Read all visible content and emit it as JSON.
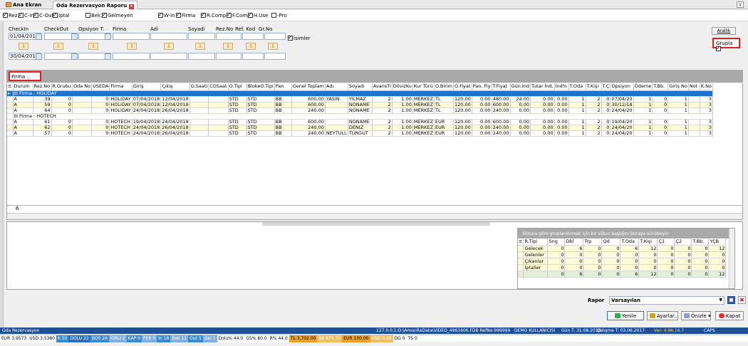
{
  "tabs": {
    "home": "Ana Ekran",
    "active": "Oda Rezervasyon Raporu",
    "close_glyph": "x",
    "chevron_glyph": "v"
  },
  "filters": [
    {
      "label": "Rez.",
      "checked": true
    },
    {
      "label": "C-In",
      "checked": true
    },
    {
      "label": "C-Out",
      "checked": true
    },
    {
      "label": "İptal",
      "checked": true
    },
    {
      "label": "Bek.",
      "checked": false
    },
    {
      "label": "Gelmeyen",
      "checked": true
    },
    {
      "label": "W-In",
      "checked": true
    },
    {
      "label": "Firma",
      "checked": true
    },
    {
      "label": "R.Comp",
      "checked": true
    },
    {
      "label": "F.Comp",
      "checked": true
    },
    {
      "label": "H.Use",
      "checked": true
    },
    {
      "label": "-Pro",
      "checked": false
    }
  ],
  "criteria": {
    "labels": [
      "CheckIn",
      "CheckOut",
      "Opsiyon T.",
      "Firma",
      "Adi",
      "Soyadi",
      "Rez.No",
      "Ref. Kod",
      "Gr.No"
    ],
    "checkin_from": "01/04/2018",
    "checkin_to": "30/04/2018",
    "isimler_label": "İsimler",
    "arallik_label": "Arallık",
    "grupla_label": "Grupla"
  },
  "group_chip": "Firma",
  "grid": {
    "columns": [
      "Durum",
      "Rez.No",
      "R.Grubu",
      "Oda No",
      "USEDA",
      "Firma",
      "Giriş",
      "Çıkış",
      "G.Saati",
      "COSaat",
      "O.Tipi",
      "BlokeO.Tipi",
      "Pan",
      "Genel Toplam",
      "Adı",
      "Soyadı",
      "AvansTi",
      "DövizKu",
      "Kur Türü",
      "O.Birim",
      "G.Fiyat",
      "Pan. Fiy",
      "T.Fiyat",
      "Gün.İnd",
      "Tutar İnd.",
      "İnd%",
      "T.Oda",
      "T.Kişi",
      "T.Ç",
      "Opsiyon",
      "Ödeme",
      "T.Bb.",
      "Giriş No",
      "Not",
      "K.No"
    ],
    "groups": [
      {
        "header": "Firma : HOLIDAY",
        "rows": [
          [
            "A",
            "39",
            "0",
            "",
            "0",
            "HOLIDAY",
            "07/04/2018",
            "12/04/2018",
            "",
            "",
            "STD",
            "STD",
            "BB",
            "600.00",
            "YASIN",
            "YILMAZ",
            "2",
            "1.00",
            "MERKEZ",
            "TL",
            "120.00",
            "0.00",
            "480.00",
            "24.00",
            "0.00",
            "0.00",
            "1",
            "2",
            "0",
            "07/04/20",
            "1",
            "0",
            "1",
            "",
            "3"
          ],
          [
            "A",
            "59",
            "0",
            "",
            "0",
            "HOLIDAY",
            "07/04/2018",
            "12/04/2018",
            "",
            "",
            "STD",
            "STD",
            "BB",
            "600.00",
            "",
            "NONAME",
            "2",
            "1.00",
            "MERKEZ",
            "TL",
            "120.00",
            "0.00",
            "600.00",
            "0.00",
            "0.00",
            "0.00",
            "1",
            "2",
            "0",
            "30/12/18",
            "1",
            "0",
            "1",
            "",
            "3"
          ],
          [
            "A",
            "64",
            "0",
            "",
            "0",
            "HOLIDAY",
            "24/04/2018",
            "26/04/2018",
            "",
            "",
            "STD",
            "STD",
            "BB",
            "240.00",
            "",
            "NONAME",
            "2",
            "1.00",
            "MERKEZ",
            "TL",
            "120.00",
            "0.00",
            "240.00",
            "0.00",
            "0.00",
            "0.00",
            "1",
            "2",
            "0",
            "24/04/20",
            "1",
            "0",
            "1",
            "",
            "3"
          ]
        ]
      },
      {
        "header": "Firma : HOTECH",
        "rows": [
          [
            "A",
            "61",
            "0",
            "",
            "0",
            "HOTECH",
            "19/04/2018",
            "24/04/2018",
            "",
            "",
            "STD",
            "STD",
            "BB",
            "600.00",
            "",
            "NONAME",
            "2",
            "1.00",
            "MERKEZ",
            "EUR",
            "120.00",
            "0.00",
            "600.00",
            "0.00",
            "0.00",
            "0.00",
            "1",
            "2",
            "0",
            "19/04/20",
            "1",
            "0",
            "1",
            "",
            "3"
          ],
          [
            "A",
            "62",
            "0",
            "",
            "0",
            "HOTECH",
            "24/04/2018",
            "26/04/2018",
            "",
            "",
            "STD",
            "STD",
            "BB",
            "240.00",
            "",
            "DENIZ",
            "2",
            "1.00",
            "MERKEZ",
            "EUR",
            "120.00",
            "0.00",
            "240.00",
            "0.00",
            "0.00",
            "0.00",
            "1",
            "2",
            "0",
            "24/04/20",
            "1",
            "0",
            "1",
            "",
            "3"
          ],
          [
            "A",
            "57",
            "0",
            "",
            "0",
            "HOTECH",
            "24/04/2018",
            "26/04/2018",
            "",
            "",
            "STD",
            "STD",
            "BB",
            "240.00",
            "NEYTULL",
            "TURGUT",
            "2",
            "1.00",
            "MERKEZ",
            "EUR",
            "120.00",
            "0.00",
            "240.00",
            "0.00",
            "0.00",
            "0.00",
            "1",
            "2",
            "0",
            "24/04/20",
            "1",
            "0",
            "1",
            "",
            "3"
          ]
        ]
      }
    ],
    "footer_count": "6"
  },
  "pivot": {
    "hint": "Sütuna göre gruplandırmak için bir sütun başlığını buraya sürükleyin",
    "columns": [
      "R.Tipi",
      "Sng",
      "Dbl",
      "Trp",
      "Qd",
      "T.Oda",
      "T.Kişi",
      "Ç1",
      "Ç2",
      "T.Bb.",
      "YÇB"
    ],
    "rows": [
      [
        "Gelecek",
        "0",
        "6",
        "0",
        "0",
        "6",
        "12",
        "0",
        "0",
        "0",
        "12"
      ],
      [
        "Gelenler",
        "0",
        "0",
        "0",
        "0",
        "0",
        "0",
        "0",
        "0",
        "0",
        "0"
      ],
      [
        "Çıkanlar",
        "0",
        "0",
        "0",
        "0",
        "0",
        "0",
        "0",
        "0",
        "0",
        "0"
      ],
      [
        "İptaller",
        "0",
        "0",
        "0",
        "0",
        "0",
        "0",
        "0",
        "0",
        "0",
        "0"
      ]
    ],
    "total": [
      "",
      "0",
      "6",
      "0",
      "0",
      "6",
      "12",
      "0",
      "0",
      "0",
      "12"
    ]
  },
  "report": {
    "label": "Rapor",
    "selected": "Varsayılan"
  },
  "actions": {
    "yenile": "Yenile",
    "ayarlar": "Ayarlar..",
    "onizle": "Önizle",
    "kapat": "Kapat"
  },
  "status": {
    "app": "Oda Rezervasyon",
    "db": "127.0.0.1:D:\\AmonRaData\\VIDEO_4961606.FDB RefNo:999999",
    "user": "DEMO KULLANICISI",
    "day": "Gün T: 31.08.2018",
    "work": "Çalışma T: 03.06.2017",
    "version": "Ver: 4.96.16.7",
    "caps": "CAPS"
  },
  "currency": [
    {
      "text": "EUR 3.9573",
      "bg": "#ffffff",
      "fg": "#000000"
    },
    {
      "text": "USD 3.5380",
      "bg": "#ffffff",
      "fg": "#000000"
    },
    {
      "text": "K 50",
      "bg": "#3a8ad0",
      "fg": "#ffffff"
    },
    {
      "text": "DOLU 22",
      "bg": "#2a6fc0",
      "fg": "#ffffff"
    },
    {
      "text": "BOS 26",
      "bg": "#3a8ad0",
      "fg": "#ffffff"
    },
    {
      "text": "KIRLI 2",
      "bg": "#7fb0e0",
      "fg": "#ffffff"
    },
    {
      "text": "KAP 0",
      "bg": "#3a8ad0",
      "fg": "#ffffff"
    },
    {
      "text": "PER 0",
      "bg": "#7fb0e0",
      "fg": "#ffffff"
    },
    {
      "text": "In 18",
      "bg": "#3a8ad0",
      "fg": "#ffffff"
    },
    {
      "text": "Bek 11",
      "bg": "#7fb0e0",
      "fg": "#ffffff"
    },
    {
      "text": "Out 5",
      "bg": "#3a8ad0",
      "fg": "#ffffff"
    },
    {
      "text": "Gel 1",
      "bg": "#7fb0e0",
      "fg": "#ffffff"
    },
    {
      "text": "Dolu% 44.0",
      "bg": "#ffffff",
      "fg": "#000000"
    },
    {
      "text": "GS% 60.0",
      "bg": "#ffffff",
      "fg": "#000000"
    },
    {
      "text": "R% 44.0",
      "bg": "#ffffff",
      "fg": "#000000"
    },
    {
      "text": "TL 3,702.00",
      "bg": "#f0a020",
      "fg": "#000000"
    },
    {
      "text": "KK 875.72",
      "bg": "#f0c060",
      "fg": "#ffffff"
    },
    {
      "text": "EUR 100.00",
      "bg": "#f0a020",
      "fg": "#000000"
    },
    {
      "text": "USD 0.00",
      "bg": "#f0c060",
      "fg": "#ffffff"
    },
    {
      "text": "DG 0",
      "bg": "#ffffff",
      "fg": "#000000"
    },
    {
      "text": "TS 0",
      "bg": "#ffffff",
      "fg": "#000000"
    }
  ],
  "colors": {
    "selected_group": "#1c72ce",
    "alt_row": "#fdfbd8",
    "highlight_border": "#e02020",
    "statusbar": "#1f4f95"
  }
}
